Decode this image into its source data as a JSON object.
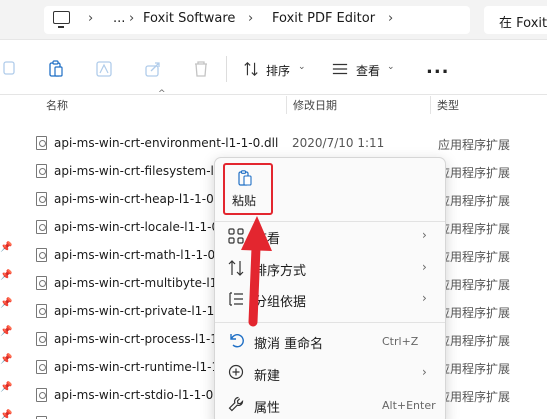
{
  "address_bar": {
    "crumbs": [
      "Foxit Software",
      "Foxit PDF Editor"
    ],
    "overflow": "...",
    "search_text": "在 Foxit"
  },
  "toolbar": {
    "sort_label": "排序",
    "view_label": "查看",
    "more": "..."
  },
  "columns": {
    "name": "名称",
    "date": "修改日期",
    "type": "类型"
  },
  "files": [
    {
      "name": "api-ms-win-crt-environment-l1-1-0.dll",
      "date": "2020/7/10 1:11",
      "type": "应用程序扩展"
    },
    {
      "name": "api-ms-win-crt-filesystem-l1",
      "date": "",
      "type": "应用程序扩展"
    },
    {
      "name": "api-ms-win-crt-heap-l1-1-0",
      "date": "",
      "type": "应用程序扩展"
    },
    {
      "name": "api-ms-win-crt-locale-l1-1-0",
      "date": "",
      "type": "应用程序扩展"
    },
    {
      "name": "api-ms-win-crt-math-l1-1-0",
      "date": "",
      "type": "应用程序扩展"
    },
    {
      "name": "api-ms-win-crt-multibyte-l1",
      "date": "",
      "type": "应用程序扩展"
    },
    {
      "name": "api-ms-win-crt-private-l1-1",
      "date": "",
      "type": "应用程序扩展"
    },
    {
      "name": "api-ms-win-crt-process-l1-1",
      "date": "",
      "type": "应用程序扩展"
    },
    {
      "name": "api-ms-win-crt-runtime-l1-1",
      "date": "",
      "type": "应用程序扩展"
    },
    {
      "name": "api-ms-win-crt-stdio-l1-1-0",
      "date": "",
      "type": "应用程序扩展"
    }
  ],
  "context_menu": {
    "paste_label": "粘贴",
    "items": [
      {
        "label": "查看",
        "shortcut": "",
        "submenu": true
      },
      {
        "label": "排序方式",
        "shortcut": "",
        "submenu": true
      },
      {
        "label": "分组依据",
        "shortcut": "",
        "submenu": true
      },
      {
        "label": "撤消 重命名",
        "shortcut": "Ctrl+Z",
        "submenu": false
      },
      {
        "label": "新建",
        "shortcut": "",
        "submenu": true
      },
      {
        "label": "属性",
        "shortcut": "Alt+Enter",
        "submenu": false
      }
    ]
  },
  "colors": {
    "highlight": "#e3262f",
    "accent": "#1f6fc5"
  }
}
